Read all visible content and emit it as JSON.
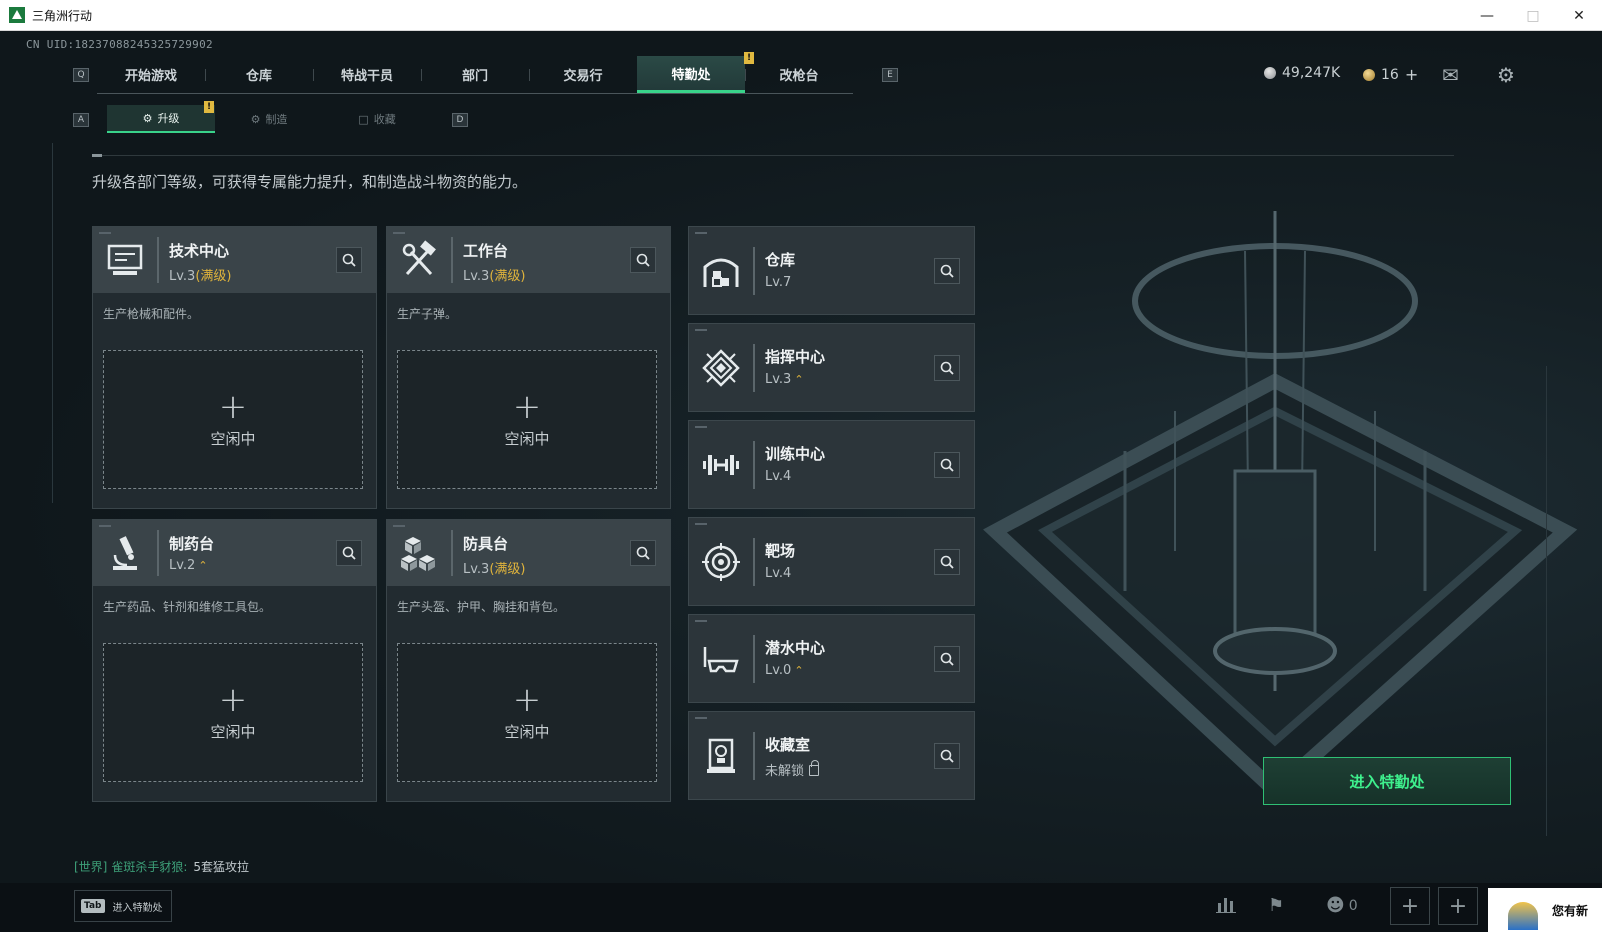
{
  "window": {
    "title": "三角洲行动"
  },
  "uid": "CN UID:18237088245325729902",
  "main_tabs": [
    {
      "label": "开始游戏"
    },
    {
      "label": "仓库"
    },
    {
      "label": "特战干员"
    },
    {
      "label": "部门"
    },
    {
      "label": "交易行"
    },
    {
      "label": "特勤处"
    },
    {
      "label": "改枪台"
    }
  ],
  "key_hints": {
    "tabs_left": "Q",
    "tabs_right": "E",
    "sub_left": "A",
    "sub_right": "D"
  },
  "alert_badge": "!",
  "currency": {
    "silver": "49,247K",
    "gold": "16"
  },
  "sub_tabs": [
    {
      "label": "升级"
    },
    {
      "label": "制造"
    },
    {
      "label": "收藏"
    }
  ],
  "description": "升级各部门等级，可获得专属能力提升，和制造战斗物资的能力。",
  "workbenches": [
    {
      "name": "技术中心",
      "level": "Lv.3",
      "status": "(满级)",
      "desc": "生产枪械和配件。",
      "slot": "空闲中",
      "icon": "computer-icon"
    },
    {
      "name": "工作台",
      "level": "Lv.3",
      "status": "(满级)",
      "desc": "生产子弹。",
      "slot": "空闲中",
      "icon": "hammer-wrench-icon"
    },
    {
      "name": "制药台",
      "level": "Lv.2",
      "status": "",
      "desc": "生产药品、针剂和维修工具包。",
      "slot": "空闲中",
      "icon": "microscope-icon"
    },
    {
      "name": "防具台",
      "level": "Lv.3",
      "status": "(满级)",
      "desc": "生产头盔、护甲、胸挂和背包。",
      "slot": "空闲中",
      "icon": "cubes-icon"
    }
  ],
  "departments": [
    {
      "name": "仓库",
      "level": "Lv.7",
      "icon": "warehouse-icon"
    },
    {
      "name": "指挥中心",
      "level": "Lv.3",
      "icon": "command-icon"
    },
    {
      "name": "训练中心",
      "level": "Lv.4",
      "icon": "dumbbell-icon"
    },
    {
      "name": "靶场",
      "level": "Lv.4",
      "icon": "target-icon"
    },
    {
      "name": "潜水中心",
      "level": "Lv.0",
      "icon": "diving-mask-icon"
    },
    {
      "name": "收藏室",
      "level": "未解锁",
      "icon": "trophy-icon"
    }
  ],
  "enter_button": "进入特勤处",
  "chat": {
    "channel": "[世界]",
    "user": "雀斑杀手豺狼:",
    "message": "5套猛攻拉"
  },
  "bottom": {
    "tab_key": "Tab",
    "tab_label": "进入特勤处",
    "friends_count": "0",
    "notification": "您有新"
  },
  "colors": {
    "accent": "#39d38a",
    "maxed": "#e0b43c",
    "background": "#10181c"
  }
}
